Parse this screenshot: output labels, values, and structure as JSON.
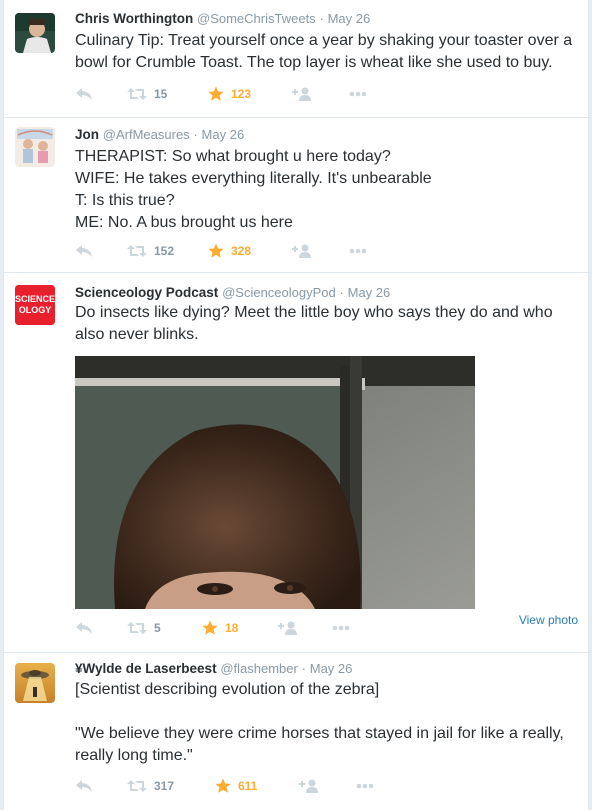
{
  "tweets": [
    {
      "fullname": "Chris Worthington",
      "handle": "@SomeChrisTweets",
      "dot": "·",
      "time": "May 26",
      "lines": [
        "Culinary Tip: Treat yourself once a year by shaking your toaster over a bowl for Crumble Toast. The top layer is wheat like she used to buy."
      ],
      "retweets": "15",
      "favorites": "123"
    },
    {
      "fullname": "Jon",
      "handle": "@ArfMeasures",
      "dot": "·",
      "time": "May 26",
      "lines": [
        "THERAPIST: So what brought u here today?",
        "WIFE: He takes everything literally. It's unbearable",
        "T: Is this true?",
        "ME: No. A bus brought us here"
      ],
      "retweets": "152",
      "favorites": "328"
    },
    {
      "fullname": "Scienceology Podcast",
      "handle": "@ScienceologyPod",
      "dot": "·",
      "time": "May 26",
      "avatar_text": "SCIENCE\nOLOGY",
      "lines": [
        "Do insects like dying? Meet the little boy who says they do and who also never blinks."
      ],
      "retweets": "5",
      "favorites": "18",
      "view_photo": "View photo"
    },
    {
      "fullname": "¥Wylde de Laserbeest",
      "handle": "@flashember",
      "dot": "·",
      "time": "May 26",
      "lines": [
        "[Scientist describing evolution of the zebra]",
        "",
        "\"We believe they were crime horses that stayed in jail for like a really, really long time.\""
      ],
      "retweets": "317",
      "favorites": "611"
    }
  ],
  "colors": {
    "link": "#2b7bb9",
    "muted": "#8899a6",
    "favorite": "#ffac33",
    "border": "#e1e8ed"
  },
  "icons": [
    "reply-icon",
    "retweet-icon",
    "favorite-star-icon",
    "follow-icon",
    "more-icon"
  ]
}
